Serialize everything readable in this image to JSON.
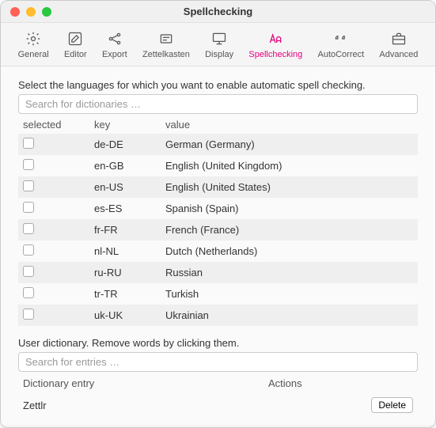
{
  "window": {
    "title": "Spellchecking"
  },
  "toolbar": {
    "items": [
      {
        "label": "General"
      },
      {
        "label": "Editor"
      },
      {
        "label": "Export"
      },
      {
        "label": "Zettelkasten"
      },
      {
        "label": "Display"
      },
      {
        "label": "Spellchecking"
      },
      {
        "label": "AutoCorrect"
      },
      {
        "label": "Advanced"
      }
    ]
  },
  "spell": {
    "instruction": "Select the languages for which you want to enable automatic spell checking.",
    "search_placeholder": "Search for dictionaries …",
    "headers": {
      "selected": "selected",
      "key": "key",
      "value": "value"
    },
    "rows": [
      {
        "key": "de-DE",
        "value": "German (Germany)"
      },
      {
        "key": "en-GB",
        "value": "English (United Kingdom)"
      },
      {
        "key": "en-US",
        "value": "English (United States)"
      },
      {
        "key": "es-ES",
        "value": "Spanish (Spain)"
      },
      {
        "key": "fr-FR",
        "value": "French (France)"
      },
      {
        "key": "nl-NL",
        "value": "Dutch (Netherlands)"
      },
      {
        "key": "ru-RU",
        "value": "Russian"
      },
      {
        "key": "tr-TR",
        "value": "Turkish"
      },
      {
        "key": "uk-UK",
        "value": "Ukrainian"
      }
    ]
  },
  "userdict": {
    "instruction": "User dictionary. Remove words by clicking them.",
    "search_placeholder": "Search for entries …",
    "headers": {
      "entry": "Dictionary entry",
      "actions": "Actions"
    },
    "rows": [
      {
        "entry": "Zettlr"
      }
    ],
    "delete_label": "Delete"
  }
}
